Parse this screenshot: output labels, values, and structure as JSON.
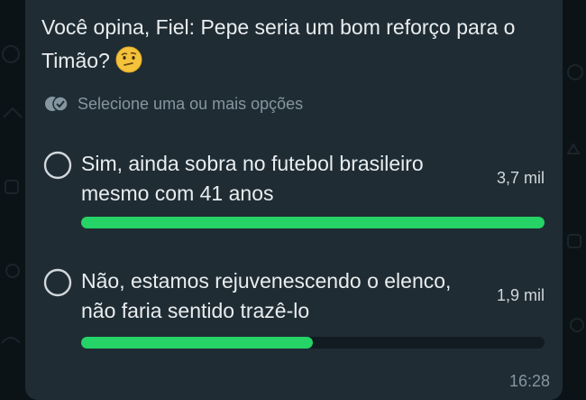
{
  "poll": {
    "question": "Você opina, Fiel: Pepe seria um bom reforço para o Timão?",
    "question_emoji": "thinking-face-icon",
    "hint": "Selecione uma ou mais opções",
    "options": [
      {
        "label": "Sim, ainda sobra no futebol brasileiro mesmo com 41 anos",
        "count": "3,7 mil",
        "share": 1.0
      },
      {
        "label": "Não, estamos rejuvenescendo o elenco, não faria sentido trazê-lo",
        "count": "1,9 mil",
        "share": 0.5
      }
    ],
    "timestamp": "16:28"
  },
  "colors": {
    "bubble": "#1f2c34",
    "accent": "#25d366",
    "text": "#e9edef",
    "muted": "#8696a0",
    "background": "#0c1317"
  }
}
